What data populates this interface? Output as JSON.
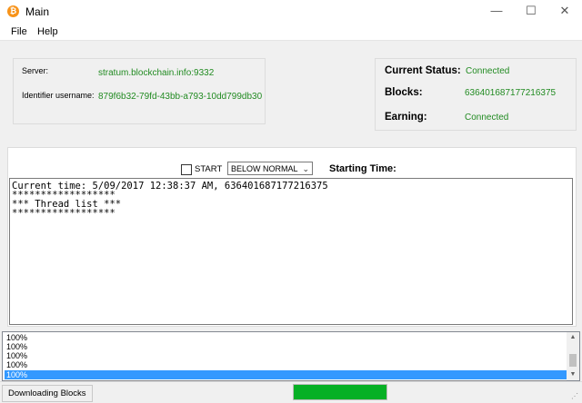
{
  "window": {
    "title": "Main",
    "icon": "bitcoin-icon",
    "min_glyph": "—",
    "max_glyph": "☐",
    "close_glyph": "✕"
  },
  "menu": [
    "File",
    "Help"
  ],
  "connection": {
    "server_label": "Server:",
    "server_value": "stratum.blockchain.info:9332",
    "identifier_label": "Identifier username:",
    "identifier_value": "879f6b32-79fd-43bb-a793-10dd799db30"
  },
  "status": {
    "current_status_label": "Current Status:",
    "current_status_value": "Connected",
    "blocks_label": "Blocks:",
    "blocks_value": "636401687177216375",
    "earning_label": "Earning:",
    "earning_value": "Connected"
  },
  "controls": {
    "start_label": "START",
    "start_checked": false,
    "priority_selected": "BELOW NORMAL",
    "starting_time_label": "Starting Time:"
  },
  "log_lines": [
    "Current time: 5/09/2017 12:38:37 AM, 636401687177216375",
    "******************",
    "*** Thread list ***",
    "******************"
  ],
  "progress_list": {
    "items": [
      "100%",
      "100%",
      "100%",
      "100%",
      "100%"
    ],
    "selected_index": 4
  },
  "statusbar": {
    "text": "Downloading Blocks",
    "progress_fraction": 1.0,
    "progress_color": "#06b025"
  },
  "colors": {
    "value_green": "#228b22",
    "selection": "#3399ff"
  }
}
